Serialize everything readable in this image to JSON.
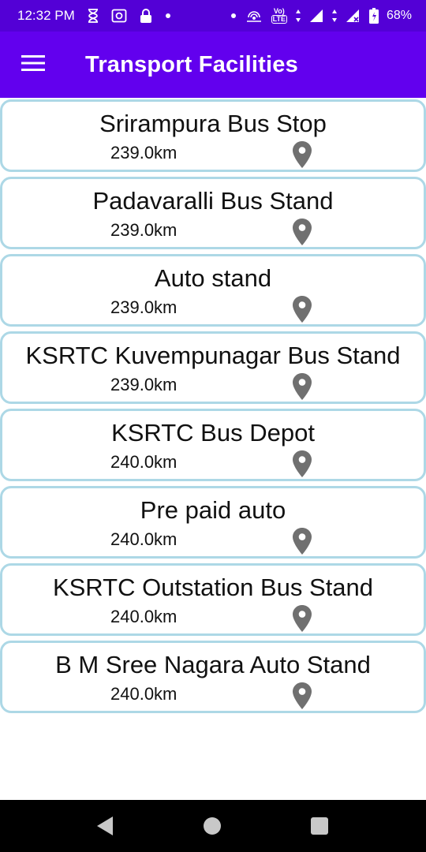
{
  "status_bar": {
    "time": "12:32 PM",
    "battery_percent": "68%",
    "network_label_top": "Vo)",
    "network_label_bottom": "LTE"
  },
  "app_bar": {
    "title": "Transport Facilities",
    "menu_icon": "hamburger-menu-icon"
  },
  "facilities": [
    {
      "name": "Srirampura Bus Stop",
      "distance": "239.0km"
    },
    {
      "name": "Padavaralli Bus Stand",
      "distance": "239.0km"
    },
    {
      "name": "Auto stand",
      "distance": "239.0km"
    },
    {
      "name": "KSRTC Kuvempunagar Bus Stand",
      "distance": "239.0km"
    },
    {
      "name": "KSRTC Bus Depot",
      "distance": "240.0km"
    },
    {
      "name": "Pre paid auto",
      "distance": "240.0km"
    },
    {
      "name": "KSRTC Outstation Bus Stand",
      "distance": "240.0km"
    },
    {
      "name": "B M Sree Nagara Auto Stand",
      "distance": "240.0km"
    }
  ],
  "colors": {
    "status_bar": "#5300d6",
    "app_bar": "#6200ee",
    "card_border": "#add8e6",
    "pin": "#707070",
    "nav_bar": "#000000"
  }
}
